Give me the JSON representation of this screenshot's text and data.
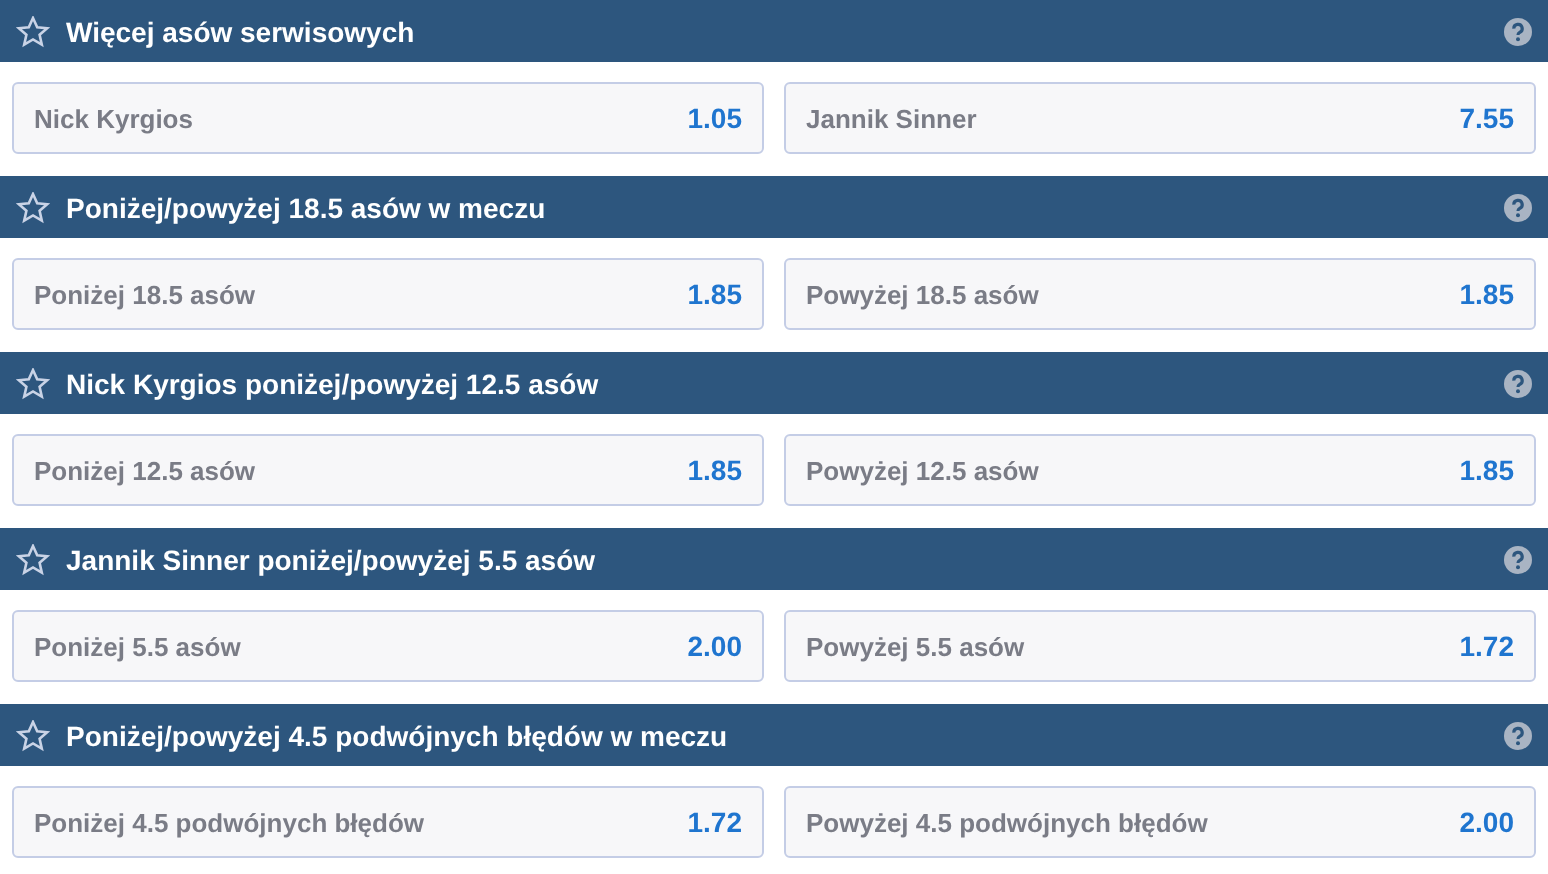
{
  "markets": [
    {
      "title": "Więcej asów serwisowych",
      "outcomes": [
        {
          "label": "Nick Kyrgios",
          "odds": "1.05"
        },
        {
          "label": "Jannik Sinner",
          "odds": "7.55"
        }
      ]
    },
    {
      "title": "Poniżej/powyżej 18.5 asów w meczu",
      "outcomes": [
        {
          "label": "Poniżej 18.5 asów",
          "odds": "1.85"
        },
        {
          "label": "Powyżej 18.5 asów",
          "odds": "1.85"
        }
      ]
    },
    {
      "title": "Nick Kyrgios poniżej/powyżej 12.5 asów",
      "outcomes": [
        {
          "label": "Poniżej 12.5 asów",
          "odds": "1.85"
        },
        {
          "label": "Powyżej 12.5 asów",
          "odds": "1.85"
        }
      ]
    },
    {
      "title": "Jannik Sinner poniżej/powyżej 5.5 asów",
      "outcomes": [
        {
          "label": "Poniżej 5.5 asów",
          "odds": "2.00"
        },
        {
          "label": "Powyżej 5.5 asów",
          "odds": "1.72"
        }
      ]
    },
    {
      "title": "Poniżej/powyżej 4.5 podwójnych błędów w meczu",
      "outcomes": [
        {
          "label": "Poniżej 4.5 podwójnych błędów",
          "odds": "1.72"
        },
        {
          "label": "Powyżej 4.5 podwójnych błędów",
          "odds": "2.00"
        }
      ]
    }
  ]
}
